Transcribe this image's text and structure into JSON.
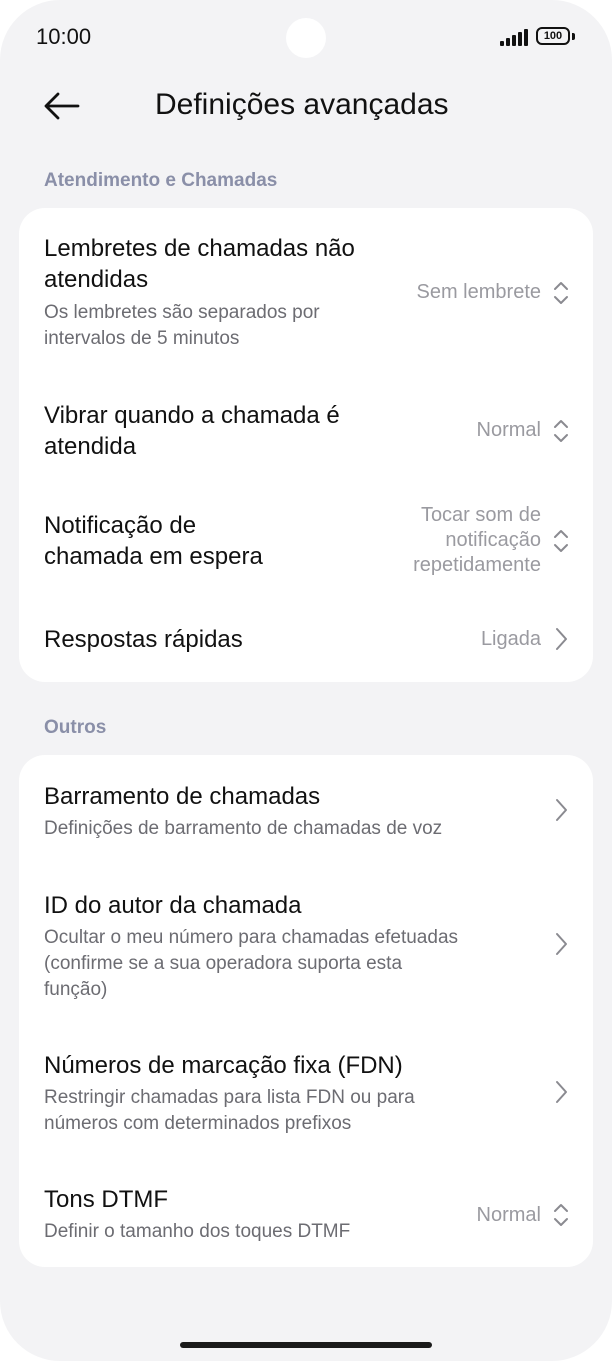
{
  "status": {
    "time": "10:00",
    "battery": "100"
  },
  "header": {
    "title": "Definições avançadas"
  },
  "sections": [
    {
      "title": "Atendimento e Chamadas",
      "items": [
        {
          "title_line1": "Lembretes de chamadas não",
          "title_line2": "atendidas",
          "sub_line1": "Os lembretes são separados por",
          "sub_line2": "intervalos de 5 minutos",
          "value": "Sem lembrete"
        },
        {
          "title_line1": "Vibrar quando a chamada é",
          "title_line2": "atendida",
          "value": "Normal"
        },
        {
          "title_line1": "Notificação de",
          "title_line2": "chamada em espera",
          "value_line1": "Tocar som de",
          "value_line2": "notificação",
          "value_line3": "repetidamente"
        },
        {
          "title_line1": "Respostas rápidas",
          "value": "Ligada"
        }
      ]
    },
    {
      "title": "Outros",
      "items": [
        {
          "title_line1": "Barramento de chamadas",
          "sub_line1": "Definições de barramento de chamadas de voz"
        },
        {
          "title_line1": "ID do autor da chamada",
          "sub_line1": "Ocultar o meu número para chamadas efetuadas",
          "sub_line2": "(confirme se a sua operadora suporta esta",
          "sub_line3": "função)"
        },
        {
          "title_line1": "Números de marcação fixa (FDN)",
          "sub_line1": "Restringir chamadas para lista FDN ou para",
          "sub_line2": "números com determinados prefixos"
        },
        {
          "title_line1": "Tons DTMF",
          "sub_line1": "Definir o tamanho dos toques DTMF",
          "value": "Normal"
        }
      ]
    }
  ],
  "icons": {
    "back": "arrow-left-icon",
    "updown": "chevron-up-down-icon",
    "right": "chevron-right-icon"
  }
}
